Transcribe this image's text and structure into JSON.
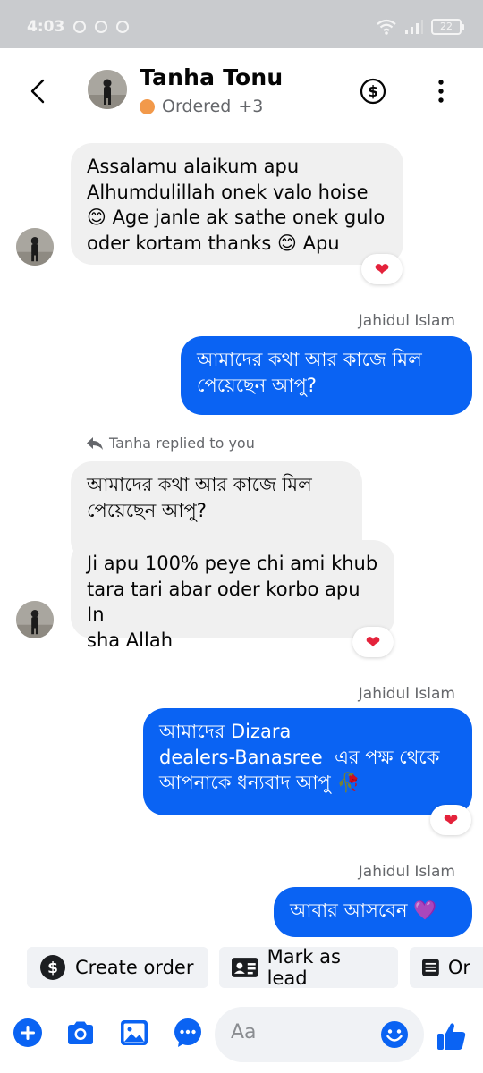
{
  "status_bar": {
    "time": "4:03",
    "battery": "22"
  },
  "header": {
    "contact_name": "Tanha Tonu",
    "status_label": "Ordered",
    "status_extra": "+3",
    "status_color": "#f2994a"
  },
  "messages": [
    {
      "direction": "incoming",
      "text": "Assalamu alaikum apu\nAlhumdulillah onek valo hoise\n😊 Age janle ak sathe onek gulo\noder kortam thanks 😊 Apu",
      "reaction": "❤"
    },
    {
      "direction": "outgoing",
      "sender": "Jahidul Islam",
      "text": "আমাদের কথা আর কাজে মিল\nপেয়েছেন আপু?"
    },
    {
      "direction": "incoming",
      "reply_note": "Tanha replied to you",
      "quoted": "আমাদের কথা আর কাজে মিল\nপেয়েছেন আপু?",
      "text": "Ji apu 100% peye chi ami khub\ntara tari abar oder korbo apu In\nsha Allah",
      "reaction": "❤"
    },
    {
      "direction": "outgoing",
      "sender": "Jahidul Islam",
      "text": "আমাদের Dizara\ndealers-Banasree  এর পক্ষ থেকে\nআপনাকে ধন্যবাদ আপু 🥀",
      "reaction": "❤"
    },
    {
      "direction": "outgoing",
      "sender": "Jahidul Islam",
      "text": "আবার আসবেন 💜"
    }
  ],
  "quick_actions": [
    {
      "label": "Create order",
      "icon": "dollar-icon"
    },
    {
      "label": "Mark as lead",
      "icon": "contact-card-icon"
    },
    {
      "label": "Or",
      "icon": "list-icon"
    }
  ],
  "composer": {
    "placeholder": "Aa"
  },
  "colors": {
    "brand_blue": "#0a63f3",
    "incoming_bubble": "#f0f0f0",
    "heart": "#e4223b"
  }
}
